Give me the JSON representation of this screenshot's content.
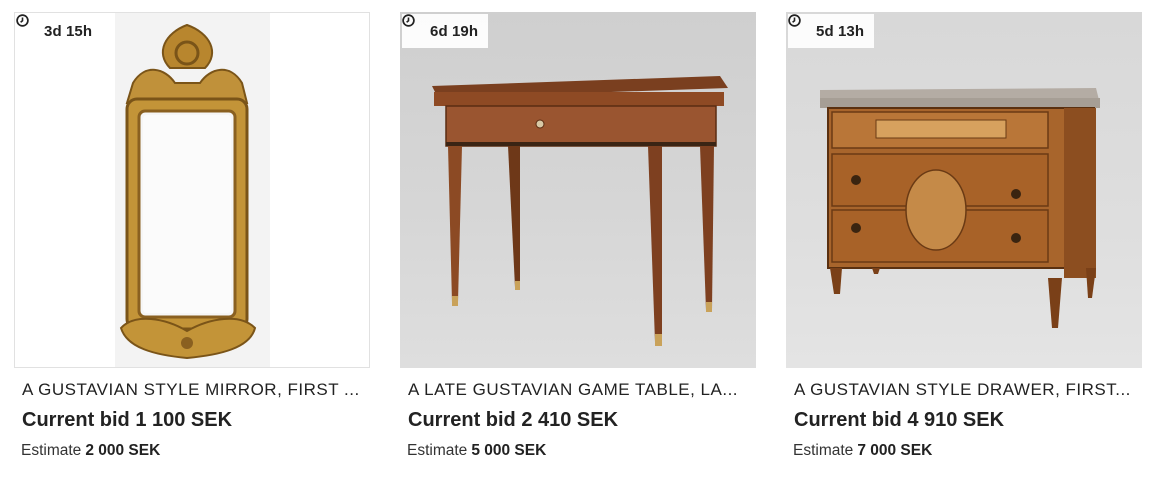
{
  "lots": [
    {
      "time_left": "3d 15h",
      "title": "A GUSTAVIAN STYLE MIRROR, FIRST ...",
      "current_bid": "Current bid 1 100 SEK",
      "estimate_label": "Estimate",
      "estimate_value": "2 000 SEK",
      "image_subject": "gilded-mirror"
    },
    {
      "time_left": "6d 19h",
      "title": "A LATE GUSTAVIAN GAME TABLE, LA...",
      "current_bid": "Current bid 2 410 SEK",
      "estimate_label": "Estimate",
      "estimate_value": "5 000 SEK",
      "image_subject": "game-table"
    },
    {
      "time_left": "5d 13h",
      "title": "A GUSTAVIAN STYLE DRAWER, FIRST...",
      "current_bid": "Current bid 4 910 SEK",
      "estimate_label": "Estimate",
      "estimate_value": "7 000 SEK",
      "image_subject": "marble-top-commode"
    }
  ],
  "icons": {
    "time": "clock-icon"
  },
  "colors": {
    "text": "#222222",
    "badge_bg": "#ffffff",
    "card_border": "#e1e1e1"
  }
}
